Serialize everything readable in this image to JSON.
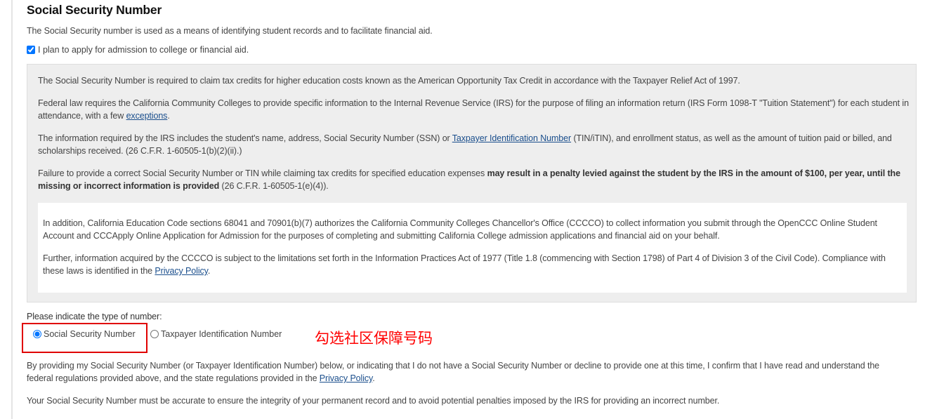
{
  "title": "Social Security Number",
  "intro": "The Social Security number is used as a means of identifying student records and to facilitate financial aid.",
  "plan_checkbox": {
    "label": "I plan to apply for admission to college or financial aid.",
    "checked": true
  },
  "info": {
    "p1": "The Social Security Number is required to claim tax credits for higher education costs known as the American Opportunity Tax Credit in accordance with the Taxpayer Relief Act of 1997.",
    "p2_text": "Federal law requires the California Community Colleges to provide specific information to the Internal Revenue Service (IRS) for the purpose of filing an information return (IRS Form 1098-T \"Tuition Statement\") for each student in attendance, with a few ",
    "p2_link": "exceptions",
    "p2_end": ".",
    "p3_text": "The information required by the IRS includes the student's name, address, Social Security Number (SSN) or ",
    "p3_link": "Taxpayer Identification Number",
    "p3_end": " (TIN/iTIN), and enrollment status, as well as the amount of tuition paid or billed, and scholarships received. (26 C.F.R. 1-60505-1(b)(2)(ii).)",
    "p4_text": "Failure to provide a correct Social Security Number or TIN while claiming tax credits for specified education expenses ",
    "p4_bold": "may result in a penalty levied against the student by the IRS in the amount of $100, per year, until the missing or incorrect information is provided",
    "p4_end": " (26 C.F.R. 1-60505-1(e)(4)).",
    "w1": "In addition, California Education Code sections 68041 and 70901(b)(7) authorizes the California Community Colleges Chancellor's Office (CCCCO) to collect information you submit through the OpenCCC Online Student Account and CCCApply Online Application for Admission for the purposes of completing and submitting California College admission applications and financial aid on your behalf.",
    "w2_text": "Further, information acquired by the CCCCO is subject to the limitations set forth in the Information Practices Act of 1977 (Title 1.8 (commencing with Section 1798) of Part 4 of Division 3 of the Civil Code). Compliance with these laws is identified in the ",
    "w2_link": "Privacy Policy",
    "w2_end": "."
  },
  "type_prompt": "Please indicate the type of number:",
  "options": [
    {
      "label": "Social Security Number",
      "selected": true
    },
    {
      "label": "Taxpayer Identification Number",
      "selected": false
    }
  ],
  "annotation": "勾选社区保障号码",
  "consent_text": "By providing my Social Security Number (or Taxpayer Identification Number) below, or indicating that I do not have a Social Security Number or decline to provide one at this time, I confirm that I have read and understand the federal regulations provided above, and the state regulations provided in the ",
  "consent_link": "Privacy Policy",
  "consent_end": ".",
  "accuracy": "Your Social Security Number must be accurate to ensure the integrity of your permanent record and to avoid potential penalties imposed by the IRS for providing an incorrect number."
}
